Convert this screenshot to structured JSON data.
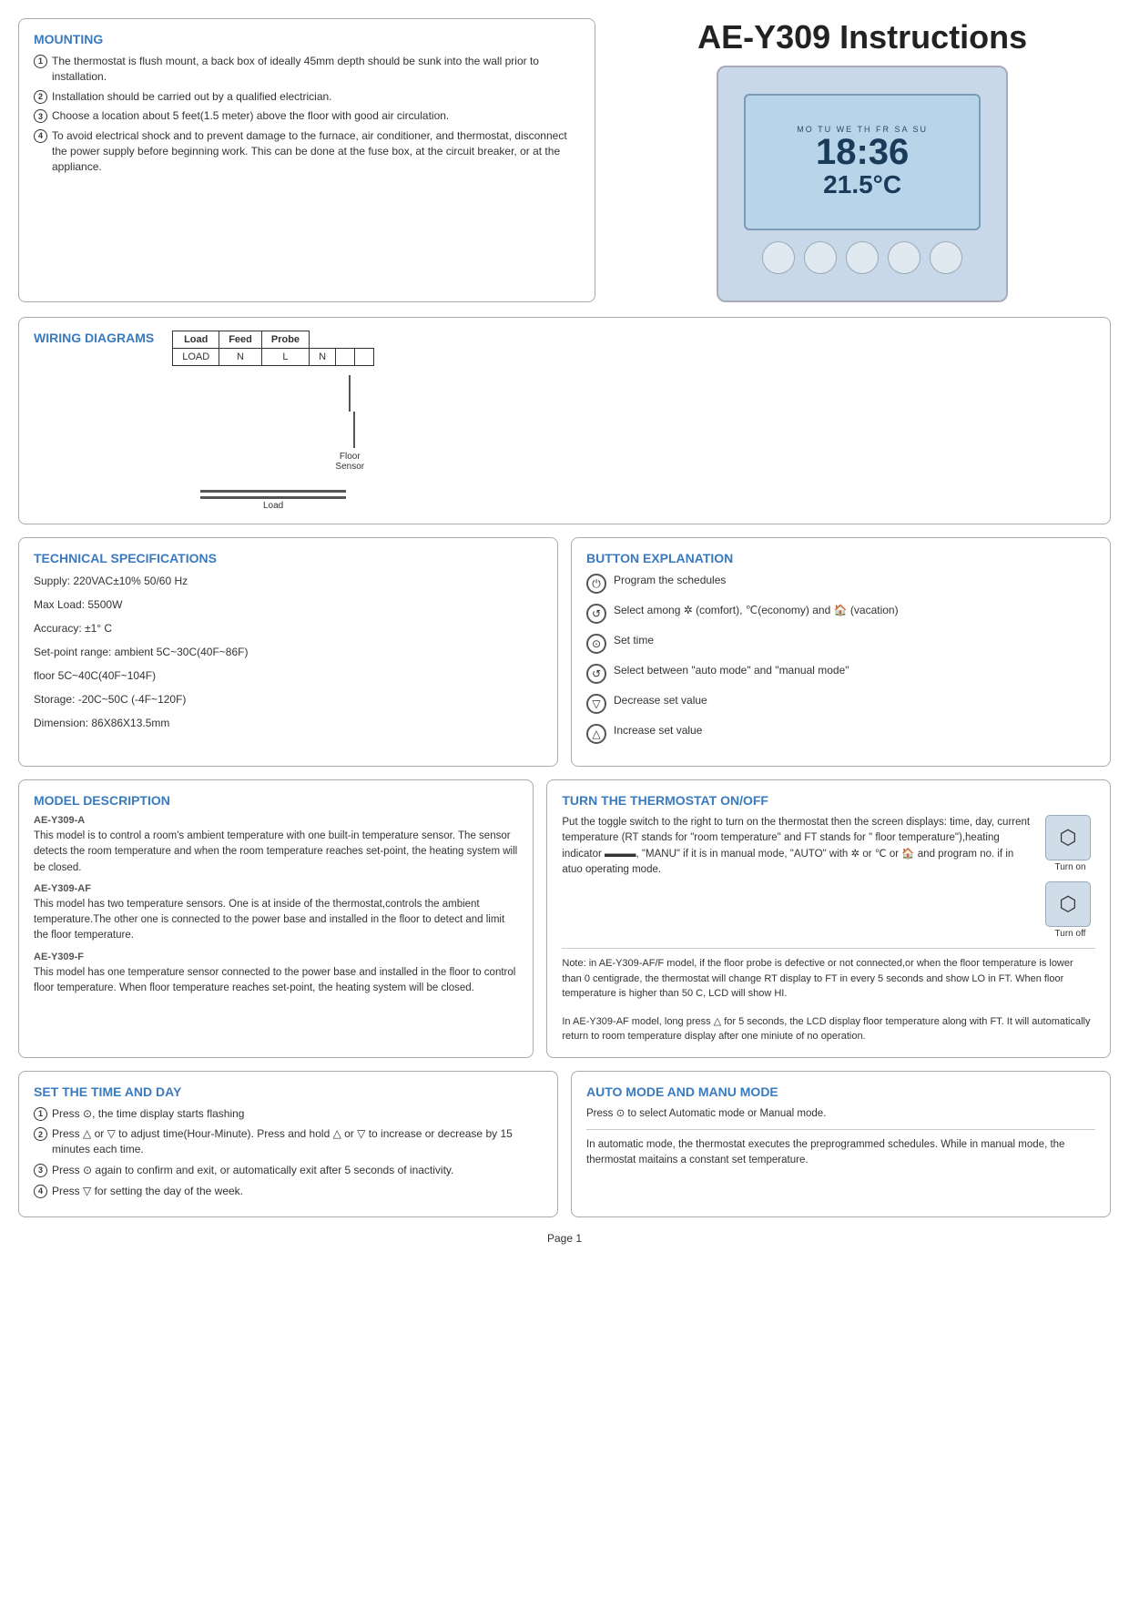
{
  "page": {
    "title": "AE-Y309 Instructions",
    "footer": "Page 1"
  },
  "mounting": {
    "title": "MOUNTING",
    "items": [
      "The thermostat is flush mount, a back box of ideally 45mm depth should be sunk into the wall prior to installation.",
      "Installation should be carried out by a qualified electrician.",
      "Choose a location about 5 feet(1.5 meter) above the floor with good air circulation.",
      "To avoid electrical shock and to prevent damage to the furnace, air conditioner, and thermostat, disconnect the power supply before beginning work. This can be done at the fuse box, at the circuit breaker, or at the appliance."
    ]
  },
  "wiring": {
    "title": "WIRING DIAGRAMS",
    "table_headers": [
      "Load",
      "Feed",
      "Probe"
    ],
    "table_row": [
      "LOAD",
      "N",
      "L",
      "N",
      "",
      ""
    ],
    "floor_sensor_label": "Floor\nSensor",
    "load_label": "Load"
  },
  "thermostat_display": {
    "time": "18:36",
    "days": "MO TU WE TH FR SA SU",
    "temp": "21.5°C"
  },
  "technical_specs": {
    "title": "TECHNICAL SPECIFICATIONS",
    "rows": [
      "Supply: 220VAC±10%  50/60 Hz",
      "Max Load: 5500W",
      "Accuracy: ±1° C",
      "Set-point range: ambient 5C~30C(40F~86F)",
      "floor       5C~40C(40F~104F)",
      "Storage: -20C~50C (-4F~120F)",
      "Dimension: 86X86X13.5mm"
    ]
  },
  "button_explanation": {
    "title": "BUTTON EXPLANATION",
    "items": [
      {
        "icon": "⏻",
        "text": "Program the schedules"
      },
      {
        "icon": "↺",
        "text": "Select among ✲ (comfort), ℃(economy) and 🏠 (vacation)"
      },
      {
        "icon": "○",
        "text": "Set time"
      },
      {
        "icon": "○",
        "text": "Select between \"auto mode\" and \"manual mode\""
      },
      {
        "icon": "▽",
        "text": "Decrease set value"
      },
      {
        "icon": "△",
        "text": "Increase set value"
      }
    ]
  },
  "model_description": {
    "title": "MODEL DESCRIPTION",
    "models": [
      {
        "name": "AE-Y309-A",
        "text": "This model is to control a room's ambient temperature with one built-in temperature sensor. The sensor detects the room temperature and when the room temperature reaches set-point, the heating system will be closed."
      },
      {
        "name": "AE-Y309-AF",
        "text": "This model has two temperature sensors. One is at inside of the thermostat,controls the ambient temperature.The other one is connected to the power base and installed in the floor to detect and limit the floor temperature."
      },
      {
        "name": "AE-Y309-F",
        "text": "This model has one temperature sensor connected to the power base and installed in the floor to control floor temperature. When floor temperature reaches set-point, the heating system will be closed."
      }
    ]
  },
  "turn_thermostat": {
    "title": "TURN THE THERMOSTAT ON/OFF",
    "text": "Put the toggle switch to the right to turn on the thermostat then the screen displays: time, day, current temperature (RT stands for \"room temperature\" and FT stands for \" floor temperature\"),heating indicator ▬▬▬, \"MANU\" if it is in manual mode, \"AUTO\" with ✲ or ℃ or 🏠 and program no. if in atuo operating mode.",
    "turn_on_label": "Turn on",
    "turn_off_label": "Turn off",
    "note": "Note: in AE-Y309-AF/F model, if the floor probe is defective or not connected,or when the floor temperature is lower than 0 centigrade, the thermostat will change RT display to FT in every 5 seconds and show LO in FT. When floor temperature is higher than 50 C, LCD will show HI.",
    "note2": "In AE-Y309-AF model, long press △ for 5 seconds, the LCD display floor temperature along with FT. It will automatically return to room temperature display after one miniute of no operation."
  },
  "set_time": {
    "title": "SET THE TIME AND DAY",
    "steps": [
      "Press ⊙, the time display starts flashing",
      "Press △ or ▽ to adjust time(Hour-Minute). Press and hold △ or ▽ to increase or decrease by 15 minutes each time.",
      "Press ⊙ again to confirm and exit, or automatically exit after 5 seconds of inactivity.",
      "Press ▽ for setting the day of the week."
    ]
  },
  "auto_mode": {
    "title": "AUTO MODE AND MANU MODE",
    "text1": "Press ⊙ to select Automatic mode or Manual mode.",
    "text2": "In automatic mode, the thermostat executes the preprogrammed schedules. While in manual mode, the thermostat maitains a constant set temperature."
  }
}
